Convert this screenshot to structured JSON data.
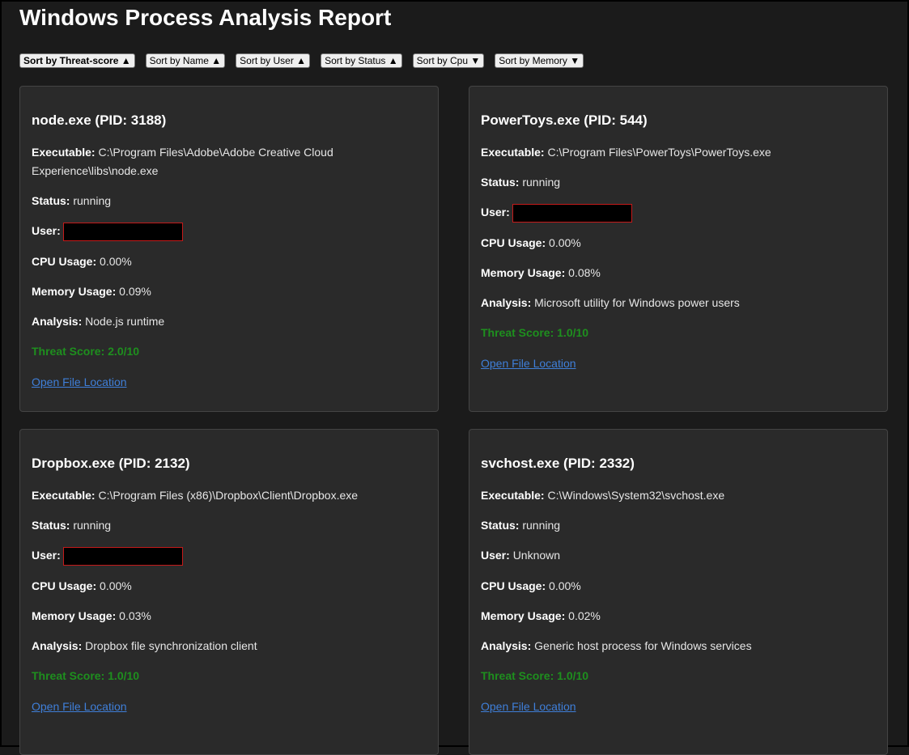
{
  "title": "Windows Process Analysis Report",
  "sort_buttons": [
    {
      "label": "Sort by Threat-score ▲"
    },
    {
      "label": "Sort by Name ▲"
    },
    {
      "label": "Sort by User ▲"
    },
    {
      "label": "Sort by Status ▲"
    },
    {
      "label": "Sort by Cpu ▼"
    },
    {
      "label": "Sort by Memory ▼"
    }
  ],
  "labels": {
    "executable": "Executable:",
    "status": "Status:",
    "user": "User:",
    "cpu": "CPU Usage:",
    "memory": "Memory Usage:",
    "analysis": "Analysis:",
    "threat_prefix": "Threat Score: ",
    "open_location": "Open File Location"
  },
  "colors": {
    "threat_low": "#1e8f1e",
    "link": "#3f7fd9",
    "redaction_border": "#c41a1a"
  },
  "processes": [
    {
      "title": "node.exe (PID: 3188)",
      "executable": "C:\\Program Files\\Adobe\\Adobe Creative Cloud Experience\\libs\\node.exe",
      "status": "running",
      "user": "",
      "user_redacted": true,
      "cpu": "0.00%",
      "memory": "0.09%",
      "analysis": "Node.js runtime",
      "threat": "2.0/10"
    },
    {
      "title": "PowerToys.exe (PID: 544)",
      "executable": "C:\\Program Files\\PowerToys\\PowerToys.exe",
      "status": "running",
      "user": "",
      "user_redacted": true,
      "cpu": "0.00%",
      "memory": "0.08%",
      "analysis": "Microsoft utility for Windows power users",
      "threat": "1.0/10"
    },
    {
      "title": "Dropbox.exe (PID: 2132)",
      "executable": "C:\\Program Files (x86)\\Dropbox\\Client\\Dropbox.exe",
      "status": "running",
      "user": "",
      "user_redacted": true,
      "cpu": "0.00%",
      "memory": "0.03%",
      "analysis": "Dropbox file synchronization client",
      "threat": "1.0/10"
    },
    {
      "title": "svchost.exe (PID: 2332)",
      "executable": "C:\\Windows\\System32\\svchost.exe",
      "status": "running",
      "user": "Unknown",
      "user_redacted": false,
      "cpu": "0.00%",
      "memory": "0.02%",
      "analysis": "Generic host process for Windows services",
      "threat": "1.0/10"
    }
  ]
}
